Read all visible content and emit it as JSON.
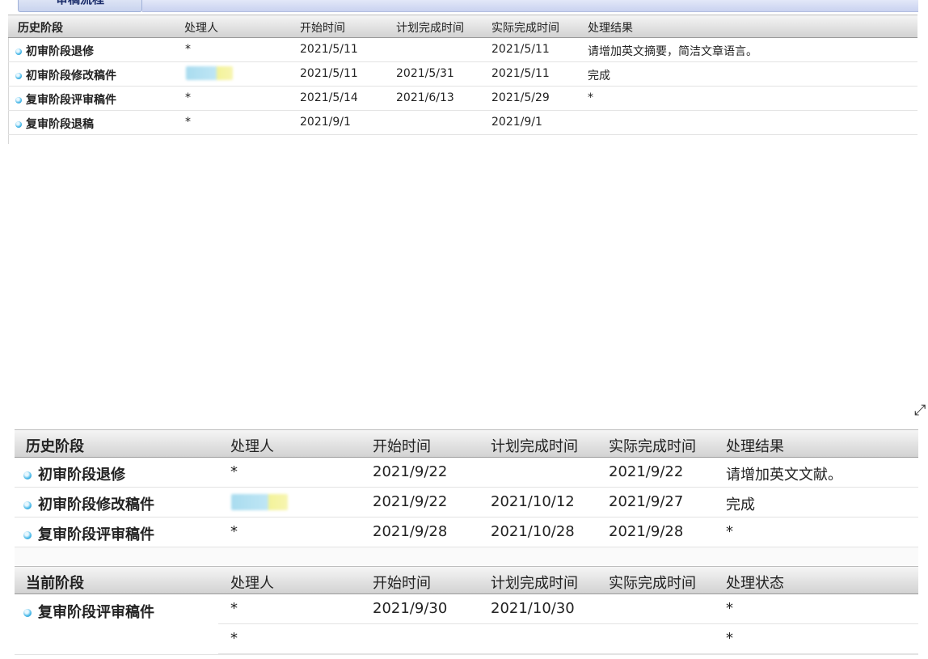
{
  "top_panel": {
    "tab_label": "审稿流程",
    "columns": [
      "历史阶段",
      "处理人",
      "开始时间",
      "计划完成时间",
      "实际完成时间",
      "处理结果"
    ],
    "rows": [
      {
        "stage": "初审阶段退修",
        "handler": "*",
        "start": "2021/5/11",
        "planned": "",
        "actual": "2021/5/11",
        "result": "请增加英文摘要，简洁文章语言。"
      },
      {
        "stage": "初审阶段修改稿件",
        "handler": "",
        "start": "2021/5/11",
        "planned": "2021/5/31",
        "actual": "2021/5/11",
        "result": "完成"
      },
      {
        "stage": "复审阶段评审稿件",
        "handler": "*",
        "start": "2021/5/14",
        "planned": "2021/6/13",
        "actual": "2021/5/29",
        "result": "*"
      },
      {
        "stage": "复审阶段退稿",
        "handler": "*",
        "start": "2021/9/1",
        "planned": "",
        "actual": "2021/9/1",
        "result": ""
      }
    ]
  },
  "bottom_panel": {
    "history_columns": [
      "历史阶段",
      "处理人",
      "开始时间",
      "计划完成时间",
      "实际完成时间",
      "处理结果"
    ],
    "history_rows": [
      {
        "stage": "初审阶段退修",
        "handler": "*",
        "start": "2021/9/22",
        "planned": "",
        "actual": "2021/9/22",
        "result": "请增加英文文献。"
      },
      {
        "stage": "初审阶段修改稿件",
        "handler": "",
        "start": "2021/9/22",
        "planned": "2021/10/12",
        "actual": "2021/9/27",
        "result": "完成"
      },
      {
        "stage": "复审阶段评审稿件",
        "handler": "*",
        "start": "2021/9/28",
        "planned": "2021/10/28",
        "actual": "2021/9/28",
        "result": "*"
      }
    ],
    "current_columns": [
      "当前阶段",
      "处理人",
      "开始时间",
      "计划完成时间",
      "实际完成时间",
      "处理状态"
    ],
    "current_stage": "复审阶段评审稿件",
    "current_rows": [
      {
        "handler": "*",
        "start": "2021/9/30",
        "planned": "2021/10/30",
        "actual": "",
        "status": "*"
      },
      {
        "handler": "*",
        "start": "",
        "planned": "",
        "actual": "",
        "status": "*"
      }
    ]
  },
  "icons": {
    "row_bullet": "bullet-circle-icon",
    "resize": "resize-diagonal-icon"
  },
  "colors": {
    "bullet": "#47b8e8",
    "header_top": "#f5f5f5",
    "header_bottom": "#d2d2d2",
    "tab_text": "#1b2d6b"
  }
}
